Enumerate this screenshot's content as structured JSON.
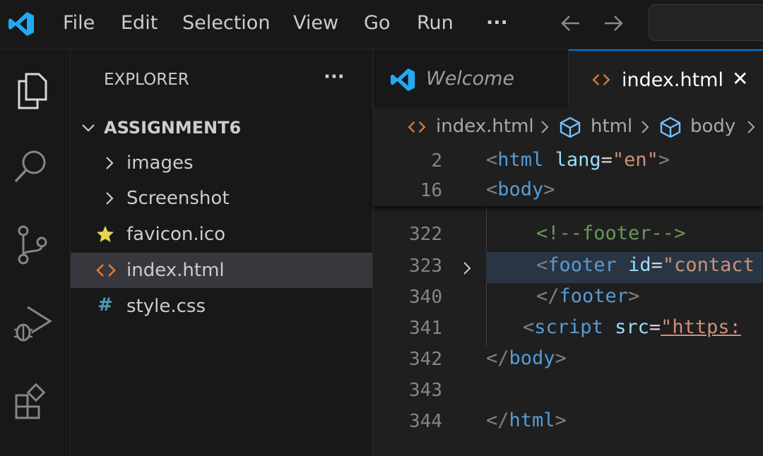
{
  "menu": [
    "File",
    "Edit",
    "Selection",
    "View",
    "Go",
    "Run",
    "···"
  ],
  "sidebar": {
    "title": "EXPLORER",
    "more": "···",
    "folder": "ASSIGNMENT6",
    "items": [
      {
        "label": "images",
        "kind": "folder"
      },
      {
        "label": "Screenshot",
        "kind": "folder"
      },
      {
        "label": "favicon.ico",
        "kind": "file",
        "icon": "star"
      },
      {
        "label": "index.html",
        "kind": "file",
        "icon": "html",
        "selected": true
      },
      {
        "label": "style.css",
        "kind": "file",
        "icon": "#"
      }
    ]
  },
  "tabs": [
    {
      "label": "Welcome",
      "active": false
    },
    {
      "label": "index.html",
      "active": true,
      "close": "✕"
    }
  ],
  "breadcrumb": [
    "index.html",
    "html",
    "body"
  ],
  "sticky": [
    {
      "num": "2",
      "t1": "<",
      "tn": "html",
      "attr": "lang",
      "eq": "=",
      "val": "\"en\"",
      "t2": ">"
    },
    {
      "num": "16",
      "t1": "<",
      "tn": "body",
      "t2": ">"
    }
  ],
  "lines": [
    {
      "num": "322",
      "comment": "<!--footer-->"
    },
    {
      "num": "323",
      "t1": "<",
      "tn": "footer",
      "attr": "id",
      "eq": "=",
      "val": "\"contact"
    },
    {
      "num": "340",
      "t1": "</",
      "tn": "footer",
      "t2": ">"
    },
    {
      "num": "341",
      "t1": "<",
      "tn": "script",
      "attr": "src",
      "eq": "=",
      "val": "\"https:"
    },
    {
      "num": "342",
      "t1": "</",
      "tn": "body",
      "t2": ">"
    },
    {
      "num": "343"
    },
    {
      "num": "344",
      "t1": "</",
      "tn": "html",
      "t2": ">"
    }
  ],
  "colors": {
    "accent": "#0078d4",
    "tag": "#569cd6",
    "attr": "#9cdcfe",
    "string": "#ce9178",
    "comment": "#6a9955",
    "html_icon": "#e37933"
  }
}
